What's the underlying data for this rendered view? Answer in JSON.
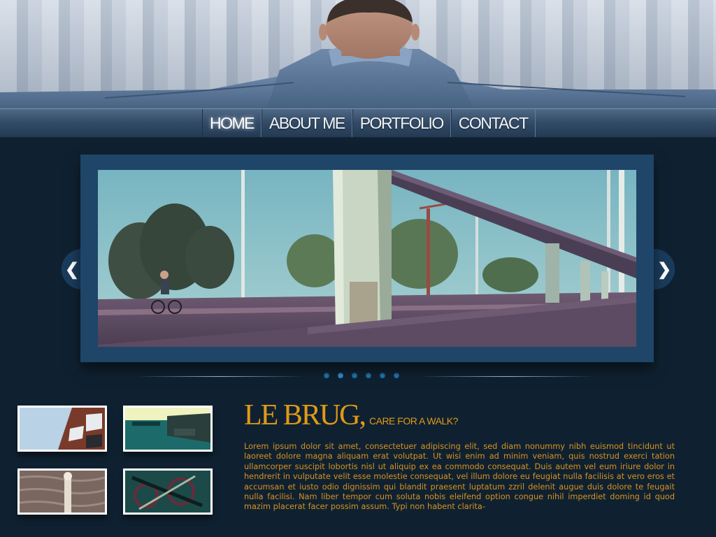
{
  "nav": {
    "items": [
      {
        "label": "HOME",
        "active": true
      },
      {
        "label": "ABOUT ME",
        "active": false
      },
      {
        "label": "PORTFOLIO",
        "active": false
      },
      {
        "label": "CONTACT",
        "active": false
      }
    ]
  },
  "slider": {
    "prev_icon": "chevron-left-icon",
    "next_icon": "chevron-right-icon",
    "prev_glyph": "❮",
    "next_glyph": "❯",
    "dot_count": 6,
    "active_dot": 1
  },
  "article": {
    "title": "LE BRUG,",
    "subtitle": "CARE FOR A WALK?",
    "body": "Lorem ipsum dolor sit amet, consectetuer adipiscing elit, sed diam nonummy nibh euismod tincidunt ut laoreet dolore magna aliquam erat volutpat. Ut wisi enim ad minim veniam, quis nostrud exerci tation ullamcorper suscipit lobortis nisl ut aliquip ex ea commodo consequat. Duis autem vel eum iriure dolor in hendrerit in vulputate velit esse molestie consequat, vel illum dolore eu feugiat nulla facilisis at vero eros et accumsan et iusto odio dignissim qui blandit praesent luptatum zzril delenit augue duis dolore te feugait nulla facilisi. Nam liber tempor cum soluta nobis eleifend option congue nihil imperdiet doming id quod mazim placerat facer possim assum. Typi non habent clarita-"
  },
  "colors": {
    "accent": "#e09a18",
    "background": "#0f2131",
    "frame": "#1f4568"
  }
}
